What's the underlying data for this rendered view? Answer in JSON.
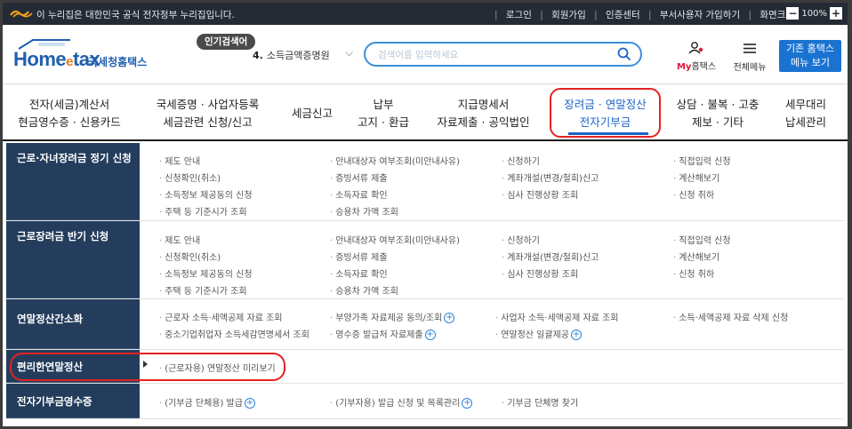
{
  "topbar": {
    "gov_notice": "이 누리집은 대한민국 공식 전자정부 누리집입니다.",
    "links": [
      "로그인",
      "회원가입",
      "인증센터",
      "부서사용자 가입하기",
      "화면크기"
    ],
    "zoom": "100%"
  },
  "header": {
    "logo_en": "Home",
    "logo_e": "e",
    "logo_en2": "tax",
    "logo_kr": "국세청홈택스",
    "popular_badge": "인기검색어",
    "popular_rank": "4.",
    "popular_term": "소득금액증명원",
    "search_placeholder": "검색어를 입력하세요",
    "my_label_my": "My",
    "my_label_rest": "홈택스",
    "allmenu_label": "전체메뉴",
    "classic_line1": "기존 홈택스",
    "classic_line2": "메뉴 보기"
  },
  "gnb": [
    {
      "line1": "전자(세금)계산서",
      "line2": "현금영수증 · 신용카드"
    },
    {
      "line1": "국세증명 · 사업자등록",
      "line2": "세금관련 신청/신고"
    },
    {
      "line1": "세금신고",
      "line2": ""
    },
    {
      "line1": "납부",
      "line2": "고지 · 환급"
    },
    {
      "line1": "지급명세서",
      "line2": "자료제출 · 공익법인"
    },
    {
      "line1": "장려금 · 연말정산",
      "line2": "전자기부금"
    },
    {
      "line1": "상담 · 불복 · 고충",
      "line2": "제보 · 기타"
    },
    {
      "line1": "세무대리",
      "line2": "납세관리"
    }
  ],
  "mega": {
    "r1_head": "근로·자녀장려금 정기 신청",
    "r1": [
      "제도 안내",
      "안내대상자 여부조회(미안내사유)",
      "신청하기",
      "직접입력 신청",
      "신청확인(취소)",
      "증빙서류 제출",
      "계좌개설(변경/철회)신고",
      "계산해보기",
      "소득정보 제공동의 신청",
      "소득자료 확인",
      "심사 진행상황 조회",
      "신청 취하",
      "주택 등 기준시가 조회",
      "승용차 가액 조회"
    ],
    "r2_head": "근로장려금 반기 신청",
    "r2": [
      "제도 안내",
      "안내대상자 여부조회(미안내사유)",
      "신청하기",
      "직접입력 신청",
      "신청확인(취소)",
      "증빙서류 제출",
      "계좌개설(변경/철회)신고",
      "계산해보기",
      "소득정보 제공동의 신청",
      "소득자료 확인",
      "심사 진행상황 조회",
      "신청 취하",
      "주택 등 기준시가 조회",
      "승용차 가액 조회"
    ],
    "r3_head": "연말정산간소화",
    "r3": [
      "근로자 소득·세액공제 자료 조회",
      "부양가족 자료제공 동의/조회",
      "사업자 소득·세액공제 자료 조회",
      "소득·세액공제 자료 삭제 신청",
      "중소기업취업자 소득세감면명세서 조회",
      "영수증 발급처 자료제출",
      "연말정산 일괄제공"
    ],
    "r4_head": "편리한연말정산",
    "r4": [
      "(근로자용) 연말정산 미리보기"
    ],
    "r5_head": "전자기부금영수증",
    "r5": [
      "(기부금 단체용) 발급",
      "(기부자용) 발급 신청 및 목록관리",
      "기부금 단체명 찾기"
    ]
  }
}
